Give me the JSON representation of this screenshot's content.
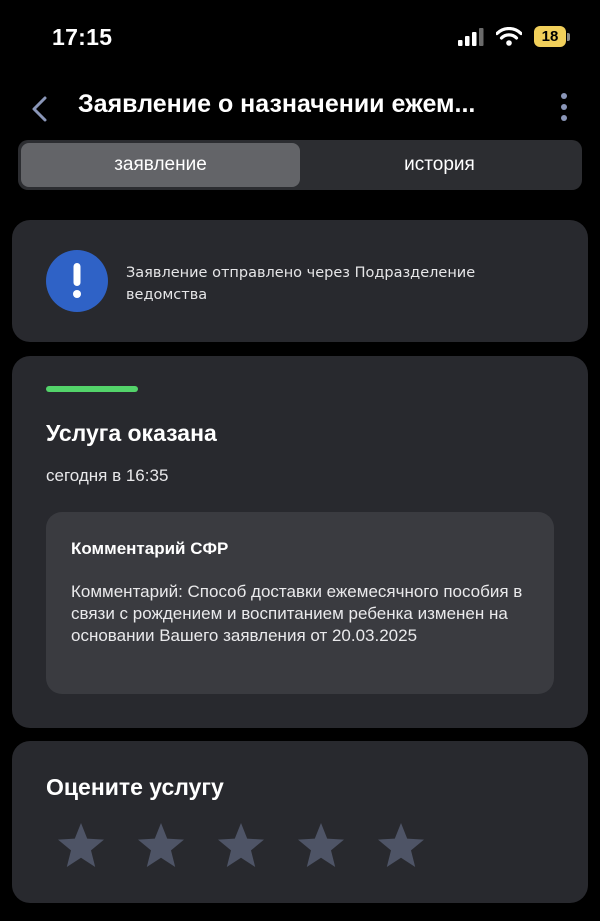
{
  "status_bar": {
    "time": "17:15",
    "battery": "18",
    "icons": [
      "signal-icon",
      "wifi-icon",
      "battery-icon"
    ]
  },
  "nav": {
    "title": "Заявление о назначении ежем...",
    "icons": [
      "chevron-left-icon",
      "more-vertical-icon"
    ]
  },
  "tabs": [
    {
      "label": "заявление",
      "active": true
    },
    {
      "label": "история",
      "active": false
    }
  ],
  "notice": {
    "text": "Заявление отправлено через Подразделение ведомства",
    "icon": "exclamation-icon",
    "icon_color": "#2f62c6"
  },
  "status": {
    "title": "Услуга оказана",
    "time": "сегодня в 16:35",
    "accent_color": "#53d36a",
    "comment": {
      "title": "Комментарий СФР",
      "text": "Комментарий: Способ доставки ежемесячного пособия в связи с рождением и воспитанием ребенка изменен на основании Вашего заявления от 20.03.2025"
    }
  },
  "rating": {
    "title": "Оцените услугу",
    "max_stars": 5,
    "selected": 0,
    "star_color": "#4e5466"
  }
}
